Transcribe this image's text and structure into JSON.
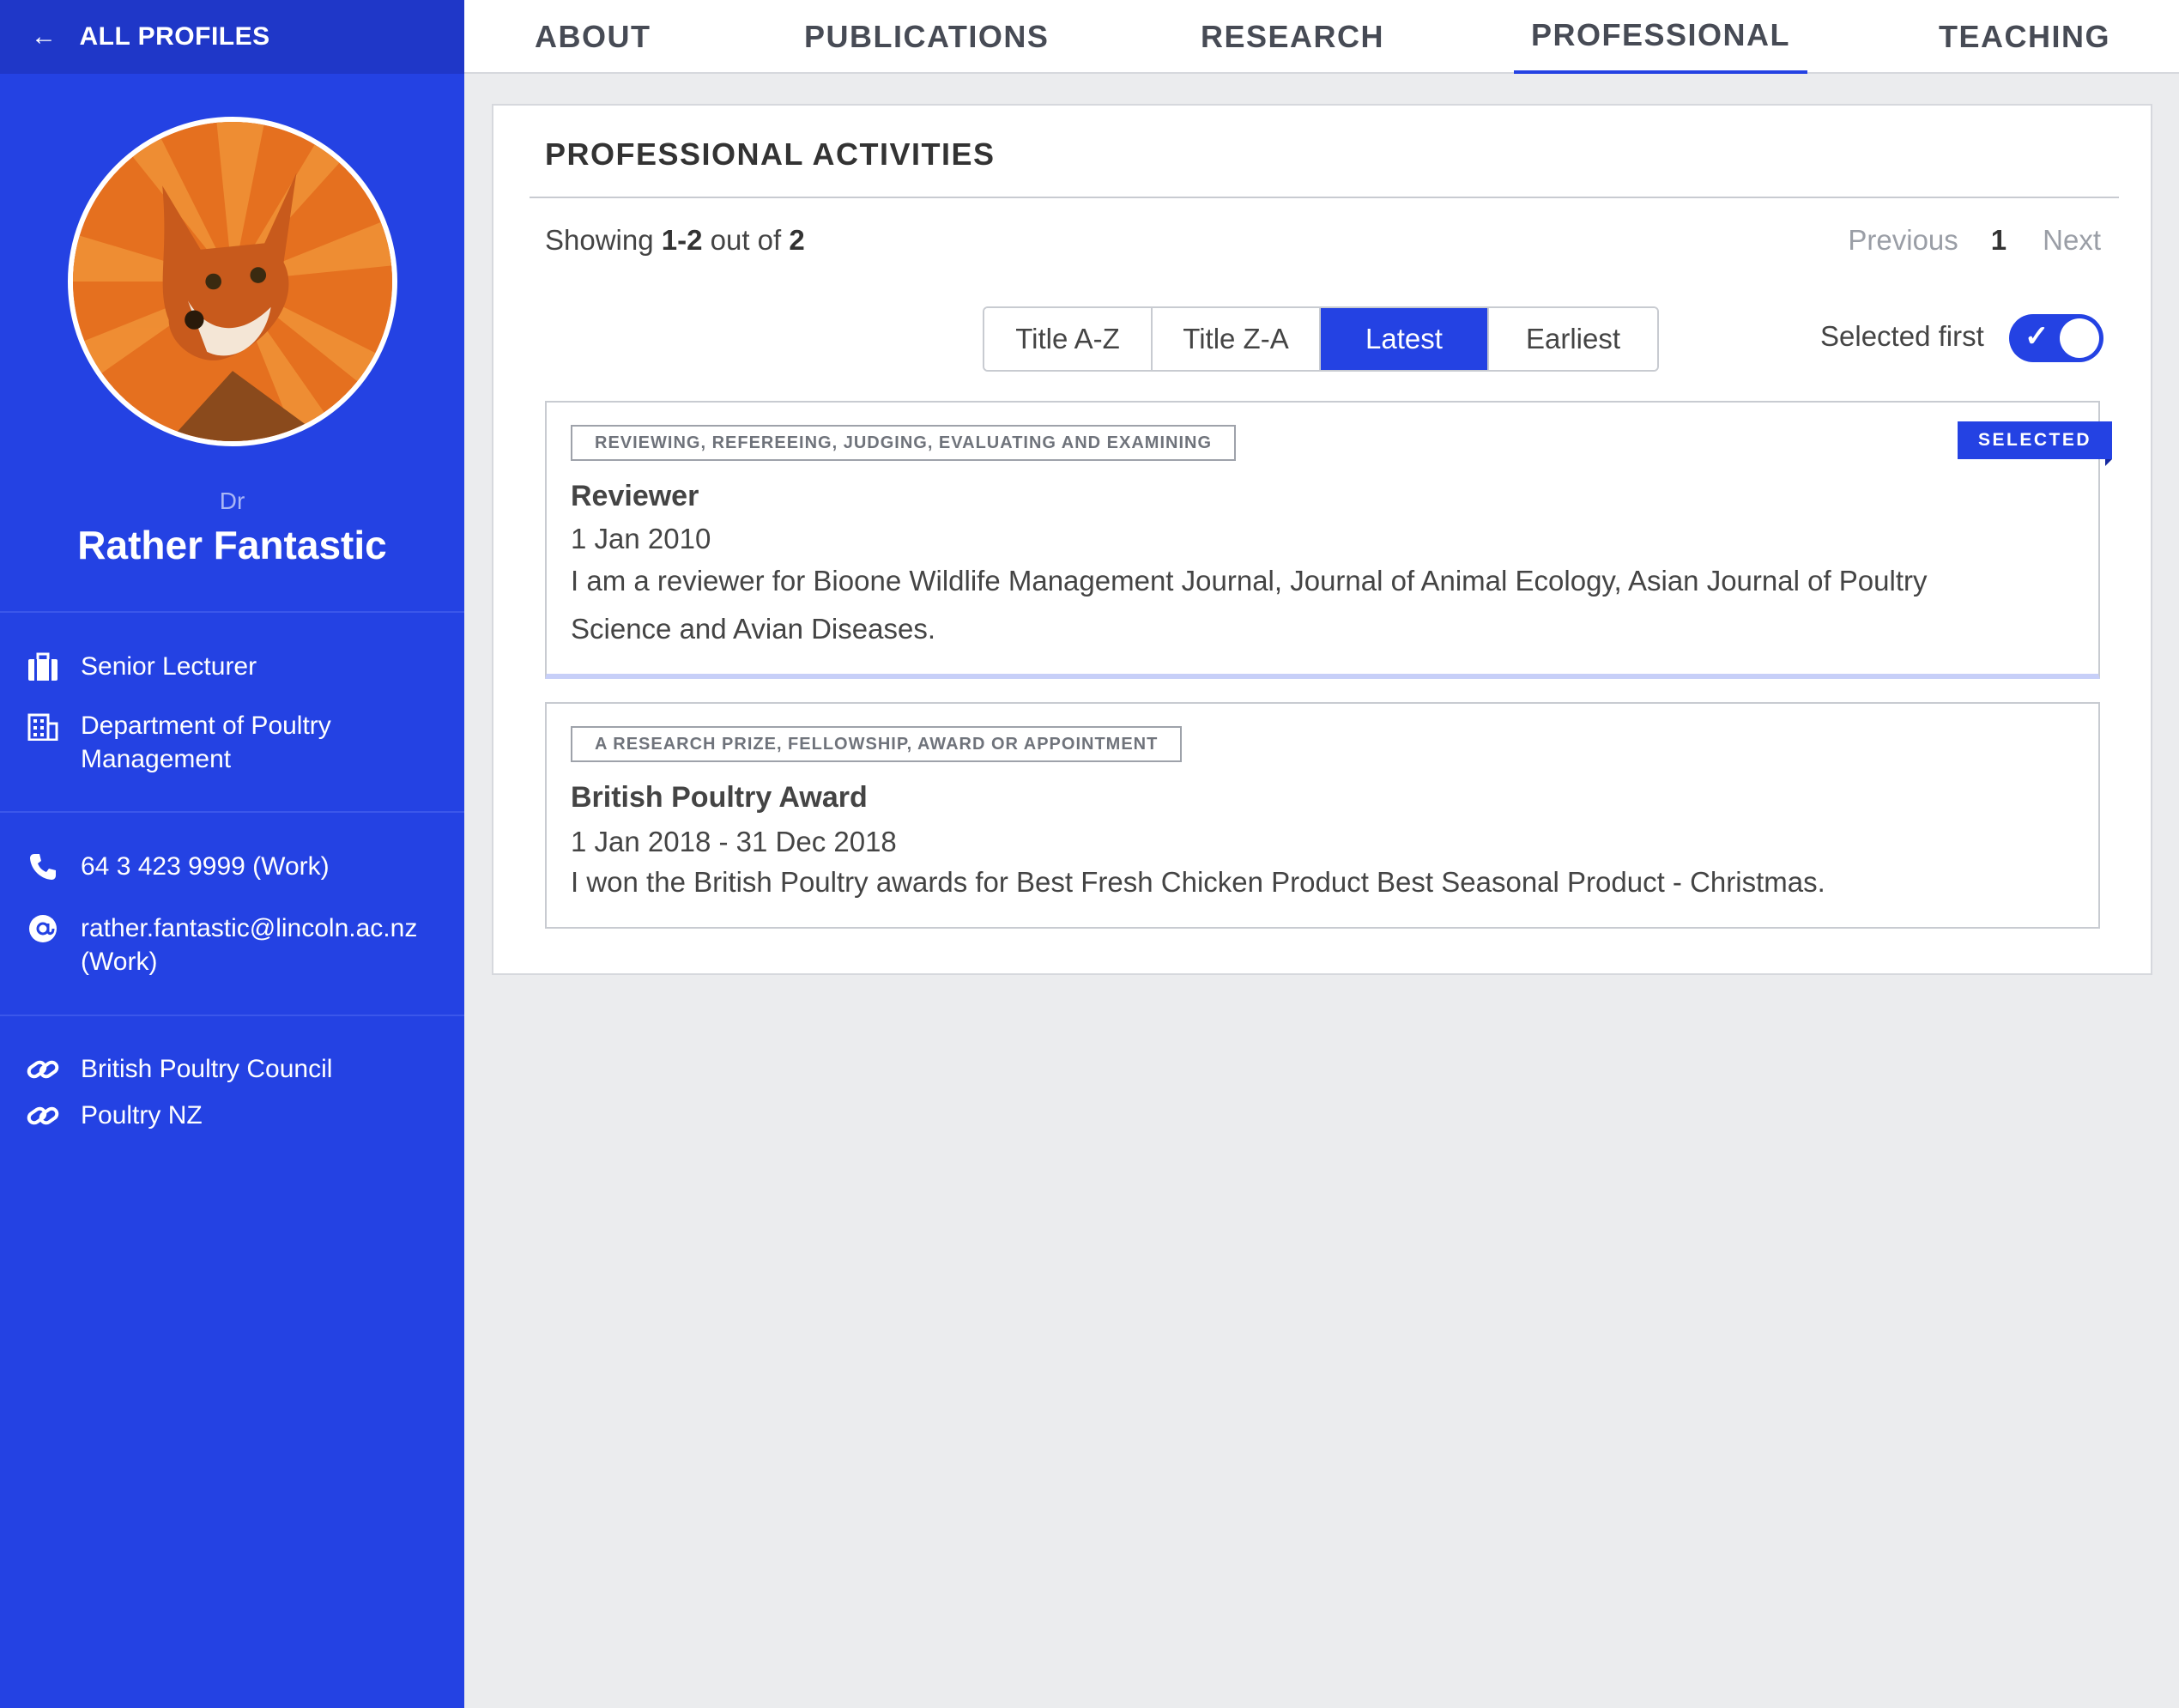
{
  "sidebar": {
    "back_label": "ALL PROFILES",
    "honorific": "Dr",
    "name": "Rather Fantastic",
    "position": "Senior Lecturer",
    "department": "Department of Poultry Management",
    "phone": "64 3 423 9999 (Work)",
    "email": "rather.fantastic@lincoln.ac.nz (Work)",
    "links": [
      "British Poultry Council",
      "Poultry NZ"
    ]
  },
  "tabs": [
    "ABOUT",
    "PUBLICATIONS",
    "RESEARCH",
    "PROFESSIONAL",
    "TEACHING"
  ],
  "active_tab": "PROFESSIONAL",
  "panel": {
    "title": "PROFESSIONAL ACTIVITIES",
    "showing_prefix": "Showing ",
    "showing_range": "1-2",
    "showing_mid": " out of ",
    "showing_total": "2",
    "pager": {
      "previous": "Previous",
      "current": "1",
      "next": "Next"
    },
    "sort_options": [
      "Title A-Z",
      "Title Z-A",
      "Latest",
      "Earliest"
    ],
    "active_sort": "Latest",
    "toggle_label": "Selected first",
    "toggle_on": true
  },
  "activities": [
    {
      "category": "REVIEWING, REFEREEING, JUDGING, EVALUATING AND EXAMINING",
      "badge": "SELECTED",
      "title": "Reviewer",
      "date": "1 Jan 2010",
      "description": "I am a reviewer for Bioone Wildlife Management Journal, Journal of Animal Ecology, Asian Journal of Poultry Science and Avian Diseases."
    },
    {
      "category": "A RESEARCH PRIZE, FELLOWSHIP, AWARD OR APPOINTMENT",
      "title": "British Poultry Award",
      "date": "1 Jan 2018 - 31 Dec 2018",
      "description": "I won the British Poultry awards for Best Fresh Chicken Product Best Seasonal Product - Christmas."
    }
  ],
  "colors": {
    "brand": "#2442e3",
    "brand_dark": "#1f37c8",
    "background": "#ebecee"
  },
  "icons": [
    "arrow-left-icon",
    "briefcase-icon",
    "building-icon",
    "phone-icon",
    "email-icon",
    "link-icon"
  ]
}
